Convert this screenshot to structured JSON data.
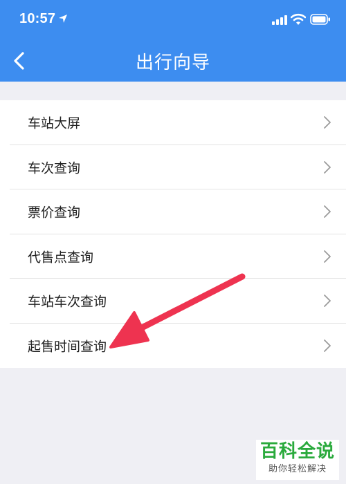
{
  "status_bar": {
    "time": "10:57"
  },
  "nav": {
    "title": "出行向导"
  },
  "menu": {
    "items": [
      {
        "label": "车站大屏"
      },
      {
        "label": "车次查询"
      },
      {
        "label": "票价查询"
      },
      {
        "label": "代售点查询"
      },
      {
        "label": "车站车次查询"
      },
      {
        "label": "起售时间查询"
      }
    ]
  },
  "watermark": {
    "title": "百科全说",
    "subtitle": "助你轻松解决"
  },
  "colors": {
    "header": "#3d8df0",
    "background": "#efeff4",
    "annotation_arrow": "#ee3350",
    "watermark": "#2aaa3c"
  },
  "icons": [
    "location-arrow-icon",
    "signal-icon",
    "wifi-icon",
    "battery-icon",
    "back-chevron-icon",
    "chevron-right-icon"
  ]
}
